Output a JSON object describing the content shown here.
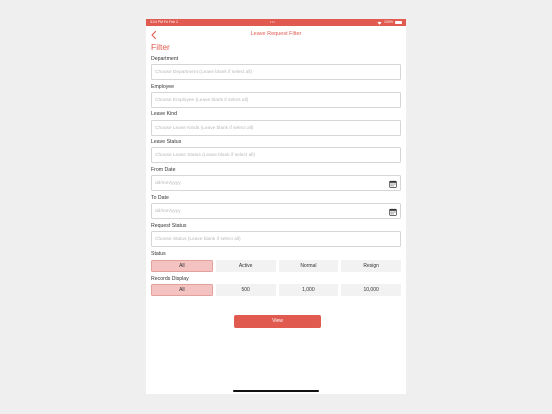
{
  "status_bar": {
    "time": "3:24 PM Fri Feb 2",
    "dots": "•••",
    "battery_pct": "100%"
  },
  "nav": {
    "title": "Leave Request Filter"
  },
  "heading": "Filter",
  "fields": {
    "department": {
      "label": "Department",
      "placeholder": "Choose Department (Leave blank if select all)"
    },
    "employee": {
      "label": "Employee",
      "placeholder": "Choose Employee (Leave blank if select all)"
    },
    "leave_kind": {
      "label": "Leave Kind",
      "placeholder": "Choose Leave Kinds (Leave blank if select all)"
    },
    "leave_status": {
      "label": "Leave Status",
      "placeholder": "Choose Leave Status (Leave blank if select all)"
    },
    "from_date": {
      "label": "From Date",
      "placeholder": "dd/mm/yyyy"
    },
    "to_date": {
      "label": "To Date",
      "placeholder": "dd/mm/yyyy"
    },
    "request_status": {
      "label": "Request Status",
      "placeholder": "Choose Status (Leave blank if select all)"
    }
  },
  "status_filter": {
    "label": "Status",
    "options": [
      "All",
      "Active",
      "Normal",
      "Resign"
    ],
    "selected": "All"
  },
  "records_display": {
    "label": "Records Display",
    "options": [
      "All",
      "500",
      "1,000",
      "10,000"
    ],
    "selected": "All"
  },
  "view_button": "View",
  "colors": {
    "accent": "#e05a4f",
    "selected_bg": "#f4c2c0",
    "segment_bg": "#f2f2f2"
  }
}
